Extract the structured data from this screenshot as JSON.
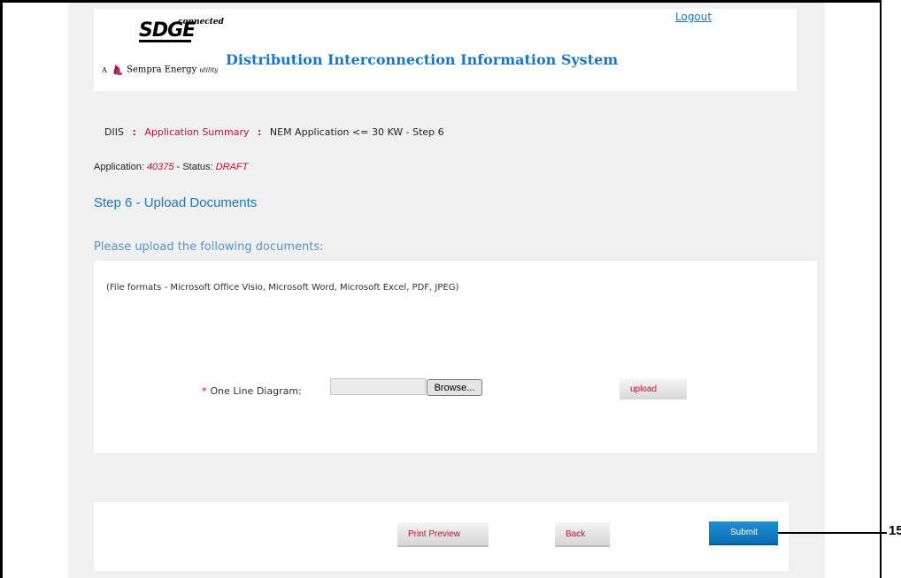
{
  "header": {
    "logo_brand": "SDGE",
    "logo_superscript": "connected",
    "logo_tagline_prefix": "A",
    "logo_tagline": "Sempra Energy",
    "logo_tagline_suffix": "utility",
    "system_title": "Distribution Interconnection Information System",
    "logout_label": "Logout"
  },
  "breadcrumb": {
    "items": [
      "DIIS",
      "Application Summary",
      "NEM Application <= 30 KW - Step 6"
    ],
    "separator": ":"
  },
  "application": {
    "label": "Application:",
    "number": "40375",
    "status_label": "- Status:",
    "status": "DRAFT"
  },
  "step": {
    "title": "Step 6 - Upload Documents",
    "instructions": "Please upload the following documents:",
    "file_formats": "(File formats - Microsoft Office Visio, Microsoft Word, Microsoft Excel, PDF, JPEG)"
  },
  "upload_field": {
    "required_marker": "*",
    "label": "One Line Diagram:",
    "value": "",
    "browse_label": "Browse...",
    "upload_label": "upload"
  },
  "footer": {
    "print_preview_label": "Print Preview",
    "back_label": "Back",
    "submit_label": "Submit"
  },
  "callout": {
    "number": "15"
  },
  "colors": {
    "accent_blue": "#1a78c2",
    "accent_red": "#c8102e",
    "submit_blue": "#1183c9",
    "page_background": "#f0f0f0"
  }
}
